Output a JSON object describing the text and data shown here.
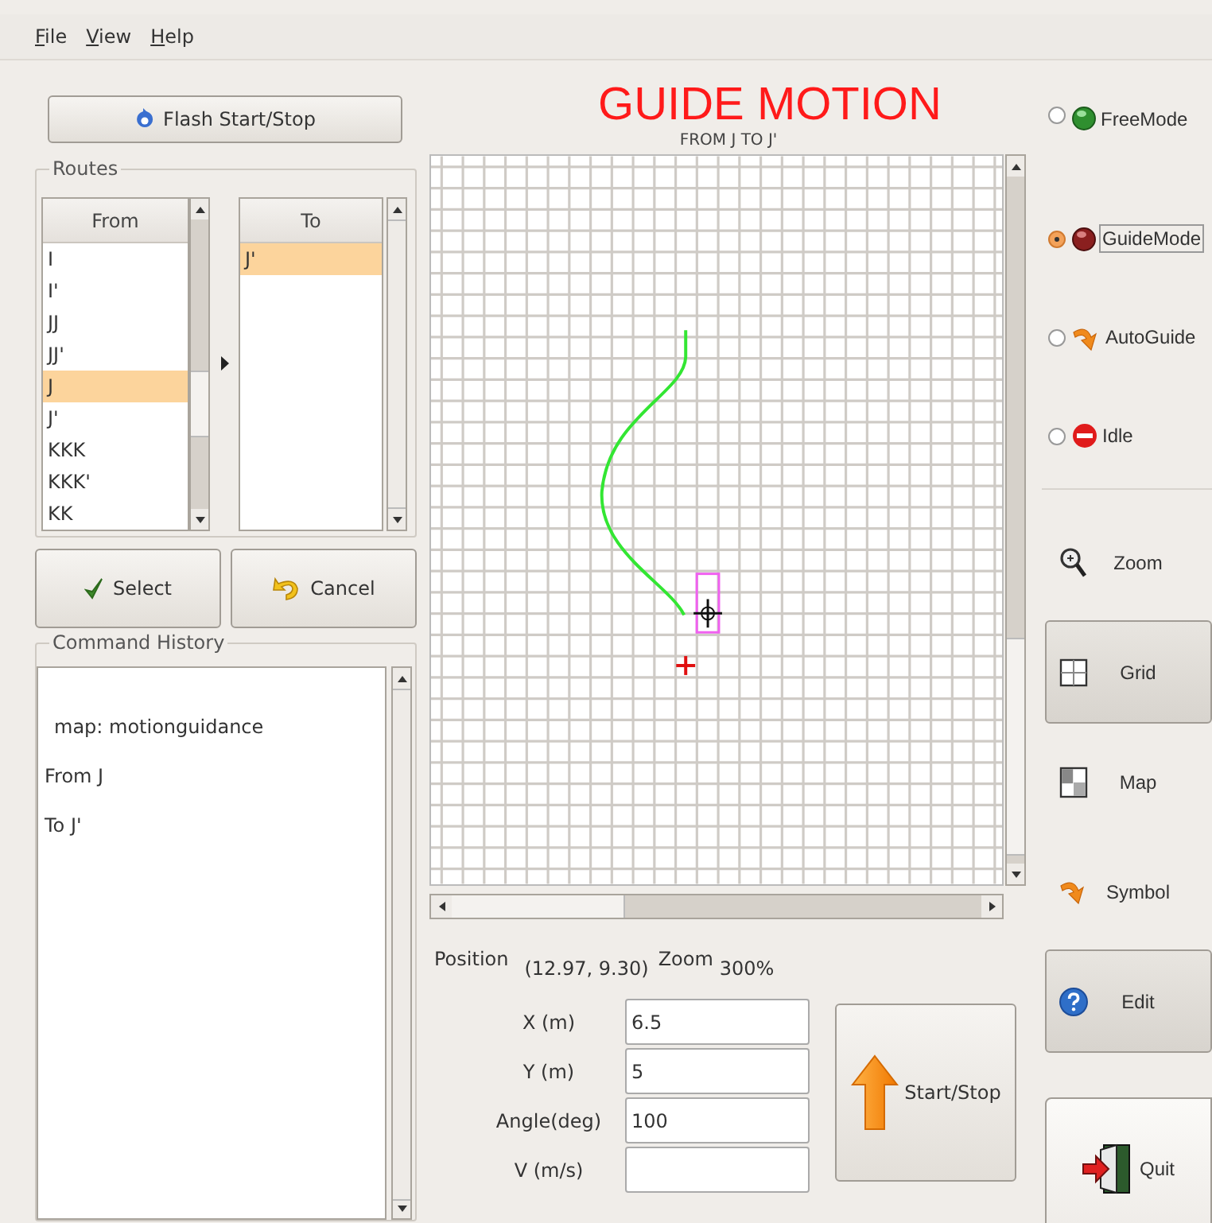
{
  "menu": [
    "File",
    "View",
    "Help"
  ],
  "flash_button": "Flash Start/Stop",
  "routes": {
    "title": "Routes",
    "from": {
      "header": "From",
      "items": [
        {
          "label": "I",
          "selected": false
        },
        {
          "label": "I'",
          "selected": false
        },
        {
          "label": "JJ",
          "selected": false
        },
        {
          "label": "JJ'",
          "selected": false
        },
        {
          "label": "J",
          "selected": true
        },
        {
          "label": "J'",
          "selected": false
        },
        {
          "label": "KKK",
          "selected": false
        },
        {
          "label": "KKK'",
          "selected": false
        },
        {
          "label": "KK",
          "selected": false
        }
      ]
    },
    "to": {
      "header": "To",
      "items": [
        {
          "label": "J'",
          "selected": true
        }
      ]
    }
  },
  "select_button": "Select",
  "cancel_button": "Cancel",
  "command_history": {
    "title": "Command History",
    "lines": [
      "map: motionguidance",
      "From J",
      "To J'"
    ]
  },
  "title": "GUIDE MOTION",
  "subtitle": "FROM J TO J'",
  "status": {
    "position_label": "Position",
    "position": "(12.97, 9.30)",
    "zoom_label": "Zoom",
    "zoom": "300%"
  },
  "fields": [
    {
      "label": "X (m)",
      "value": "6.5"
    },
    {
      "label": "Y (m)",
      "value": "5"
    },
    {
      "label": "Angle(deg)",
      "value": "100"
    },
    {
      "label": "V (m/s)"
    }
  ],
  "start_stop_button": "Start/Stop",
  "modes": [
    {
      "label": "FreeMode",
      "selected": false
    },
    {
      "label": "GuideMode",
      "selected": true
    },
    {
      "label": "AutoGuide",
      "selected": false
    },
    {
      "label": "Idle",
      "selected": false
    }
  ],
  "tools": [
    {
      "label": "Zoom",
      "pressed": false
    },
    {
      "label": "Grid",
      "pressed": true
    },
    {
      "label": "Map",
      "pressed": false
    },
    {
      "label": "Symbol",
      "pressed": false
    },
    {
      "label": "Edit",
      "pressed": true
    }
  ],
  "quit_button": "Quit"
}
